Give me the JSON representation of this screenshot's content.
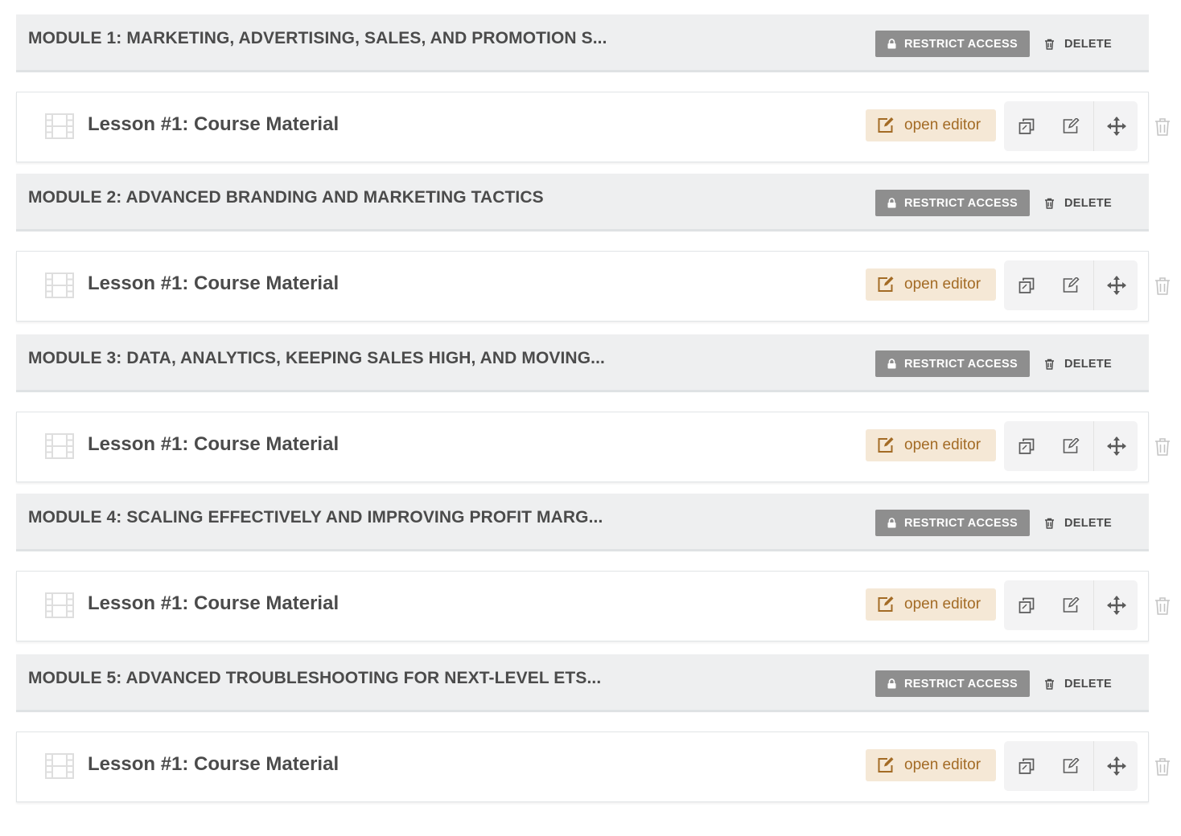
{
  "colors": {
    "module_bg": "#eeeff0",
    "restrict_bg": "#8e8e8e",
    "open_editor_bg": "#f5e8d6",
    "open_editor_text": "#a36b25",
    "text": "#4b4b4b"
  },
  "modules": [
    {
      "title": "MODULE 1: MARKETING, ADVERTISING, SALES, AND PROMOTION S...",
      "restrict_label": "RESTRICT ACCESS",
      "delete_label": "DELETE",
      "lessons": [
        {
          "title": "Lesson #1: Course Material",
          "open_editor_label": "open editor"
        }
      ]
    },
    {
      "title": "MODULE 2: ADVANCED BRANDING AND MARKETING TACTICS",
      "restrict_label": "RESTRICT ACCESS",
      "delete_label": "DELETE",
      "lessons": [
        {
          "title": "Lesson #1: Course Material",
          "open_editor_label": "open editor"
        }
      ]
    },
    {
      "title": "MODULE 3: DATA, ANALYTICS, KEEPING SALES HIGH, AND MOVING...",
      "restrict_label": "RESTRICT ACCESS",
      "delete_label": "DELETE",
      "lessons": [
        {
          "title": "Lesson #1: Course Material",
          "open_editor_label": "open editor"
        }
      ]
    },
    {
      "title": "MODULE 4: SCALING EFFECTIVELY AND IMPROVING PROFIT MARG...",
      "restrict_label": "RESTRICT ACCESS",
      "delete_label": "DELETE",
      "lessons": [
        {
          "title": "Lesson #1: Course Material",
          "open_editor_label": "open editor"
        }
      ]
    },
    {
      "title": "MODULE 5: ADVANCED TROUBLESHOOTING FOR NEXT-LEVEL ETS...",
      "restrict_label": "RESTRICT ACCESS",
      "delete_label": "DELETE",
      "lessons": [
        {
          "title": "Lesson #1: Course Material",
          "open_editor_label": "open editor"
        }
      ]
    }
  ]
}
